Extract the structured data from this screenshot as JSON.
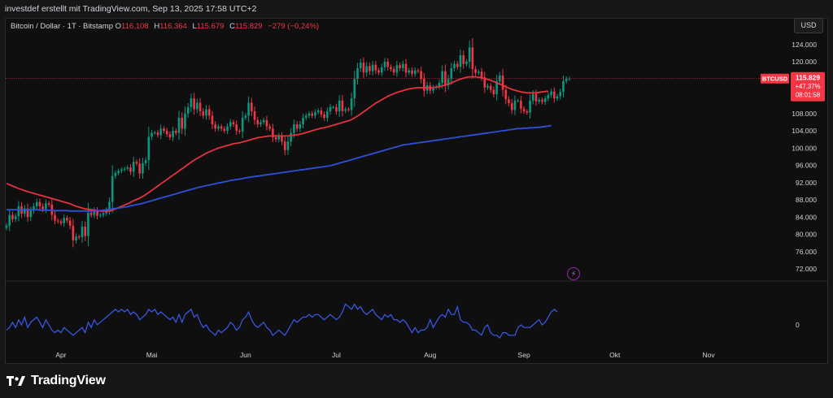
{
  "header": {
    "credit": "investdef erstellt mit TradingView.com, Sep 13, 2025 17:58 UTC+2"
  },
  "legend": {
    "symbol": "Bitcoin / Dollar · 1T · Bitstamp",
    "open_label": "O",
    "open": "116.108",
    "high_label": "H",
    "high": "116.364",
    "low_label": "L",
    "low": "115.679",
    "close_label": "C",
    "close": "115.829",
    "change": "−279 (−0,24%)"
  },
  "currency_button": "USD",
  "price_tag": {
    "symbol": "BTCUSD",
    "price": "115.829",
    "change_pct": "+47,37%",
    "countdown": "08:01:58"
  },
  "brand": "TradingView",
  "colors": {
    "up": "#089981",
    "down": "#f23645",
    "ema_short": "#e5323f",
    "ema_long": "#2f4fd8",
    "oscillator": "#3a5bf0",
    "background": "#0f0f0f"
  },
  "chart_data": [
    {
      "type": "candlestick",
      "title": "Bitcoin / Dollar · 1T · Bitstamp",
      "x_tick_labels": [
        "Apr",
        "Mai",
        "Jun",
        "Jul",
        "Aug",
        "Sep",
        "Okt",
        "Nov"
      ],
      "y_tick_labels": [
        "124.000",
        "120.000",
        "116.000",
        "112.000",
        "108.000",
        "104.000",
        "100.000",
        "96.000",
        "92.000",
        "88.000",
        "84.000",
        "80.000",
        "76.000",
        "72.000"
      ],
      "ylim": [
        70000,
        126000
      ],
      "grid": false,
      "month_start_index": {
        "Apr": 18,
        "Mai": 48,
        "Jun": 79,
        "Jul": 109,
        "Aug": 140,
        "Sep": 171,
        "Okt": 201,
        "Nov": 232
      },
      "close": [
        82000,
        84500,
        83500,
        84200,
        86500,
        84800,
        86000,
        84000,
        85500,
        86500,
        87500,
        86500,
        85800,
        87200,
        86900,
        84500,
        83200,
        83000,
        82600,
        83800,
        83200,
        82000,
        78600,
        79500,
        79300,
        81800,
        79600,
        85000,
        84500,
        85500,
        84300,
        84500,
        84900,
        85600,
        87500,
        93500,
        94200,
        94700,
        95000,
        95200,
        95500,
        94500,
        96800,
        96400,
        94100,
        96500,
        97200,
        102600,
        103500,
        103600,
        103000,
        104500,
        104000,
        103200,
        102500,
        104000,
        103500,
        107000,
        104500,
        108000,
        109500,
        111500,
        109000,
        110500,
        108500,
        107500,
        109000,
        107500,
        105500,
        104500,
        105000,
        104500,
        104000,
        105000,
        106000,
        105500,
        104000,
        103800,
        107000,
        107500,
        110500,
        108500,
        106500,
        105500,
        106000,
        106500,
        105000,
        104500,
        102500,
        102000,
        102800,
        101500,
        99500,
        101500,
        103500,
        105500,
        104500,
        105500,
        107000,
        107500,
        108000,
        107500,
        108300,
        108700,
        107800,
        107000,
        108500,
        109500,
        109500,
        108500,
        111000,
        108600,
        109000,
        108800,
        111500,
        116000,
        118500,
        119800,
        117500,
        119000,
        117800,
        119300,
        118000,
        117500,
        118700,
        120000,
        118800,
        118300,
        117500,
        119200,
        118500,
        119500,
        117500,
        118000,
        117200,
        118000,
        117800,
        116000,
        113300,
        114500,
        113300,
        114000,
        114200,
        115100,
        117800,
        114500,
        116000,
        118500,
        119500,
        118800,
        121500,
        119500,
        120000,
        123300,
        118300,
        117400,
        117700,
        116400,
        114000,
        114400,
        113500,
        112500,
        115500,
        116800,
        113500,
        111300,
        110400,
        108800,
        111000,
        111000,
        109100,
        108500,
        108200,
        111000,
        112500,
        110800,
        111200,
        110700,
        111500,
        112300,
        113100,
        111500,
        112000,
        113000,
        115500,
        116000,
        116100
      ],
      "series": [
        {
          "name": "",
          "values_step": "per-candle",
          "color": "#e5323f",
          "values": [
            91800,
            91500,
            91200,
            90900,
            90600,
            90400,
            90100,
            89900,
            89700,
            89500,
            89300,
            89100,
            88900,
            88700,
            88500,
            88300,
            88100,
            87900,
            87700,
            87500,
            87300,
            87100,
            86800,
            86500,
            86300,
            86100,
            85900,
            85800,
            85700,
            85600,
            85500,
            85400,
            85400,
            85400,
            85400,
            85600,
            85900,
            86200,
            86500,
            86800,
            87100,
            87400,
            87800,
            88100,
            88400,
            88800,
            89200,
            89700,
            90200,
            90700,
            91200,
            91700,
            92200,
            92700,
            93200,
            93700,
            94200,
            94700,
            95200,
            95700,
            96200,
            96700,
            97200,
            97600,
            98000,
            98400,
            98800,
            99100,
            99400,
            99700,
            100000,
            100200,
            100400,
            100600,
            100800,
            101000,
            101100,
            101200,
            101400,
            101600,
            101800,
            102000,
            102200,
            102400,
            102500,
            102600,
            102700,
            102800,
            102800,
            102800,
            102800,
            102800,
            102800,
            102800,
            102900,
            103000,
            103100,
            103200,
            103400,
            103600,
            103800,
            104000,
            104200,
            104400,
            104600,
            104700,
            104900,
            105100,
            105300,
            105500,
            105700,
            105900,
            106100,
            106300,
            106600,
            107000,
            107400,
            107900,
            108400,
            108900,
            109400,
            109900,
            110400,
            110800,
            111200,
            111600,
            112000,
            112300,
            112600,
            112900,
            113100,
            113300,
            113500,
            113700,
            113800,
            113900,
            114000,
            114000,
            114000,
            114000,
            114000,
            114000,
            114100,
            114200,
            114400,
            114600,
            114800,
            115100,
            115400,
            115700,
            116000,
            116200,
            116400,
            116500,
            116500,
            116500,
            116400,
            116300,
            116100,
            115900,
            115700,
            115400,
            115100,
            114800,
            114500,
            114200,
            113900,
            113600,
            113400,
            113200,
            113000,
            112900,
            112800,
            112800,
            112800,
            112800,
            112900,
            113000,
            113100,
            113200
          ]
        },
        {
          "name": "",
          "values_step": "per-candle",
          "color": "#2f4fd8",
          "values": [
            85700,
            85700,
            85700,
            85700,
            85700,
            85700,
            85700,
            85700,
            85700,
            85700,
            85700,
            85600,
            85600,
            85600,
            85600,
            85600,
            85500,
            85500,
            85500,
            85500,
            85500,
            85400,
            85400,
            85400,
            85400,
            85400,
            85400,
            85400,
            85400,
            85400,
            85500,
            85500,
            85600,
            85700,
            85800,
            85900,
            86000,
            86100,
            86200,
            86300,
            86400,
            86600,
            86700,
            86900,
            87000,
            87200,
            87400,
            87600,
            87800,
            88000,
            88200,
            88400,
            88600,
            88800,
            89000,
            89200,
            89400,
            89600,
            89800,
            90000,
            90200,
            90400,
            90600,
            90800,
            91000,
            91100,
            91300,
            91400,
            91600,
            91700,
            91900,
            92000,
            92200,
            92300,
            92500,
            92600,
            92700,
            92800,
            92900,
            93100,
            93200,
            93300,
            93400,
            93500,
            93600,
            93700,
            93800,
            93900,
            94000,
            94100,
            94200,
            94300,
            94400,
            94500,
            94600,
            94700,
            94800,
            94900,
            95000,
            95100,
            95200,
            95300,
            95400,
            95500,
            95600,
            95700,
            95800,
            95900,
            96100,
            96300,
            96500,
            96700,
            96900,
            97100,
            97300,
            97500,
            97700,
            97900,
            98100,
            98300,
            98500,
            98700,
            98900,
            99100,
            99300,
            99500,
            99700,
            99900,
            100100,
            100300,
            100500,
            100700,
            100800,
            100900,
            101000,
            101100,
            101200,
            101300,
            101400,
            101500,
            101600,
            101700,
            101800,
            101900,
            102000,
            102100,
            102200,
            102300,
            102400,
            102500,
            102600,
            102700,
            102800,
            102900,
            103000,
            103100,
            103200,
            103300,
            103400,
            103500,
            103600,
            103700,
            103800,
            103900,
            104000,
            104100,
            104200,
            104300,
            104400,
            104500,
            104500,
            104600,
            104600,
            104700,
            104700,
            104800,
            104800,
            104900,
            105000,
            105100,
            105200
          ]
        }
      ],
      "oscillator": {
        "y_tick_labels": [
          "0"
        ],
        "values": [
          -2,
          -1,
          1,
          -1,
          2,
          0,
          3,
          -1,
          1,
          2,
          3,
          1,
          -1,
          2,
          0,
          -2,
          -3,
          -2,
          -3,
          -1,
          -2,
          -3,
          -4,
          -3,
          -2,
          -1,
          -3,
          1,
          -1,
          2,
          0,
          1,
          2,
          3,
          4,
          5,
          6,
          5,
          6,
          5,
          6,
          4,
          5,
          4,
          2,
          3,
          4,
          6,
          5,
          6,
          4,
          5,
          4,
          3,
          2,
          3,
          1,
          4,
          1,
          4,
          5,
          6,
          3,
          4,
          1,
          -1,
          0,
          -2,
          -3,
          -4,
          -2,
          -3,
          -2,
          -1,
          1,
          0,
          -2,
          -1,
          2,
          3,
          5,
          2,
          0,
          -1,
          0,
          1,
          -1,
          -2,
          -4,
          -3,
          -2,
          -3,
          -4,
          -2,
          0,
          2,
          1,
          2,
          3,
          3,
          4,
          3,
          4,
          4,
          3,
          2,
          3,
          4,
          3,
          2,
          3,
          5,
          8,
          7,
          6,
          8,
          6,
          7,
          5,
          4,
          5,
          6,
          4,
          3,
          2,
          4,
          3,
          4,
          2,
          2,
          1,
          2,
          1,
          -1,
          -3,
          -1,
          -3,
          -2,
          -2,
          -1,
          2,
          -1,
          1,
          3,
          4,
          3,
          6,
          4,
          4,
          7,
          2,
          1,
          1,
          0,
          -2,
          -2,
          -3,
          -4,
          -1,
          0,
          -3,
          -4,
          -4,
          -5,
          -3,
          -3,
          -4,
          -4,
          -4,
          -1,
          0,
          -1,
          -1,
          -1,
          0,
          1,
          2,
          0,
          1,
          3,
          5,
          6,
          5
        ]
      }
    }
  ]
}
